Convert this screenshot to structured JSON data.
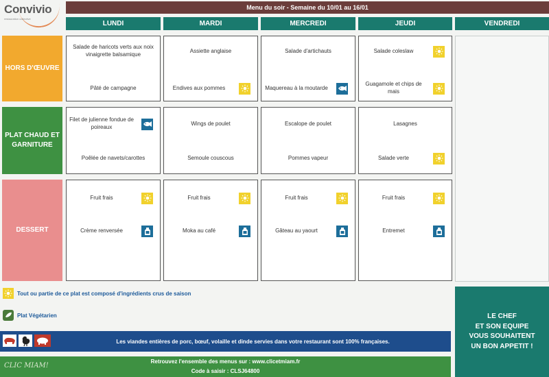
{
  "logo": {
    "name": "Convivio",
    "tagline": "restauration collective"
  },
  "banner_title": "Menu du soir - Semaine du 10/01 au 16/01",
  "days": [
    "LUNDI",
    "MARDI",
    "MERCREDI",
    "JEUDI",
    "VENDREDI"
  ],
  "categories": [
    {
      "label": "HORS D'ŒUVRE",
      "color": "#f2a92e"
    },
    {
      "label": "PLAT CHAUD ET GARNITURE",
      "color": "#3e9142"
    },
    {
      "label": "DESSERT",
      "color": "#e98e8e"
    }
  ],
  "menu": {
    "lundi": {
      "hors_oeuvre": [
        {
          "text": "Salade de haricots verts aux noix vinaigrette balsamique",
          "icon": ""
        },
        {
          "text": "Pâté de campagne",
          "icon": ""
        }
      ],
      "plat": [
        {
          "text": "Filet de julienne fondue de poireaux",
          "icon": "fish"
        },
        {
          "text": "Poêlée de navets/carottes",
          "icon": ""
        }
      ],
      "dessert": [
        {
          "text": "Fruit frais",
          "icon": "sun"
        },
        {
          "text": "Crème renversée",
          "icon": "dairy"
        }
      ]
    },
    "mardi": {
      "hors_oeuvre": [
        {
          "text": "Assiette anglaise",
          "icon": ""
        },
        {
          "text": "Endives aux pommes",
          "icon": "sun"
        }
      ],
      "plat": [
        {
          "text": "Wings de poulet",
          "icon": ""
        },
        {
          "text": "Semoule couscous",
          "icon": ""
        }
      ],
      "dessert": [
        {
          "text": "Fruit frais",
          "icon": "sun"
        },
        {
          "text": "Moka au café",
          "icon": "dairy"
        }
      ]
    },
    "mercredi": {
      "hors_oeuvre": [
        {
          "text": "Salade d'artichauts",
          "icon": ""
        },
        {
          "text": "Maquereau à la moutarde",
          "icon": "fish"
        }
      ],
      "plat": [
        {
          "text": "Escalope de poulet",
          "icon": ""
        },
        {
          "text": "Pommes vapeur",
          "icon": ""
        }
      ],
      "dessert": [
        {
          "text": "Fruit frais",
          "icon": "sun"
        },
        {
          "text": "Gâteau au yaourt",
          "icon": "dairy"
        }
      ]
    },
    "jeudi": {
      "hors_oeuvre": [
        {
          "text": "Salade coleslaw",
          "icon": "sun"
        },
        {
          "text": "Guagamole et chips de mais",
          "icon": "sun"
        }
      ],
      "plat": [
        {
          "text": "Lasagnes",
          "icon": ""
        },
        {
          "text": "Salade verte",
          "icon": "sun"
        }
      ],
      "dessert": [
        {
          "text": "Fruit frais",
          "icon": "sun"
        },
        {
          "text": "Entremet",
          "icon": "dairy"
        }
      ]
    }
  },
  "legend": {
    "seasonal": "Tout ou partie de ce plat est composé d'ingrédients crus de saison",
    "vegetarian": "Plat Végétarien"
  },
  "meat_origin": "Les viandes entières de porc, bœuf, volaille et dinde servies dans votre restaurant sont 100% françaises.",
  "footer": {
    "brand": "CLIC MIAM!",
    "line1": "Retrouvez l'ensemble des menus sur : www.clicetmiam.fr",
    "line2": "Code à saisir : CLSJ64800"
  },
  "chef_message": [
    "LE CHEF",
    "ET SON EQUIPE",
    "VOUS SOUHAITENT",
    "UN BON APPETIT !"
  ],
  "colors": {
    "banner": "#6b3d3b",
    "day_header": "#1a7a6e",
    "sun_icon": "#f1d12c",
    "fish_icon": "#1d6e9a",
    "blue_banner": "#1e4d8c",
    "green_banner": "#3e9142"
  }
}
